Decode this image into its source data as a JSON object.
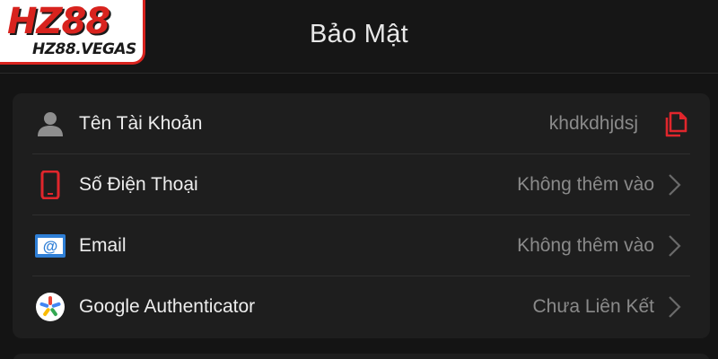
{
  "header": {
    "title": "Bảo Mật"
  },
  "logo": {
    "main": "HZ88",
    "sub": "HZ88.VEGAS"
  },
  "security": {
    "rows": [
      {
        "label": "Tên Tài Khoản",
        "value": "khdkdhjdsj",
        "icon": "user-icon",
        "action": "copy-icon"
      },
      {
        "label": "Số Điện Thoại",
        "value": "Không thêm vào",
        "icon": "phone-icon",
        "action": "chevron-right-icon"
      },
      {
        "label": "Email",
        "value": "Không thêm vào",
        "icon": "email-icon",
        "action": "chevron-right-icon"
      },
      {
        "label": "Google Authenticator",
        "value": "Chưa Liên Kết",
        "icon": "google-authenticator-icon",
        "action": "chevron-right-icon"
      }
    ]
  },
  "colors": {
    "accent_red": "#e0262c",
    "background": "#141414",
    "card": "#1e1e1e",
    "label": "#ededed",
    "value": "#8a8a8a"
  }
}
